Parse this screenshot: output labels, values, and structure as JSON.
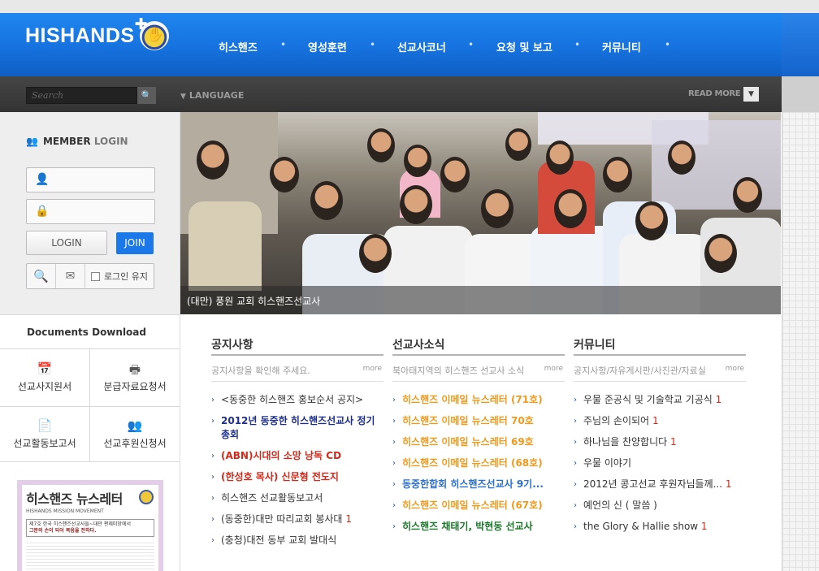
{
  "brand": {
    "logo_text": "HISHANDS",
    "logo_icon": "hand-cross-icon"
  },
  "nav": {
    "items": [
      {
        "label": "히스핸즈"
      },
      {
        "label": "영성훈련"
      },
      {
        "label": "선교사코너"
      },
      {
        "label": "요청 및 보고"
      },
      {
        "label": "커뮤니티"
      }
    ]
  },
  "toolbar": {
    "search_placeholder": "Search",
    "language_label": "LANGUAGE",
    "read_more_label": "READ MORE"
  },
  "member": {
    "title_bold": "MEMBER",
    "title_light": "LOGIN",
    "login_label": "LOGIN",
    "join_label": "JOIN",
    "keep_login_label": "로그인 유지"
  },
  "documents": {
    "title": "Documents Download",
    "items": [
      {
        "label": "선교사지원서",
        "icon": "calendar-icon"
      },
      {
        "label": "분급자료요청서",
        "icon": "printer-icon"
      },
      {
        "label": "선교활동보고서",
        "icon": "document-icon"
      },
      {
        "label": "선교후원신청서",
        "icon": "users-icon"
      }
    ]
  },
  "newsletter": {
    "title": "히스핸즈 뉴스레터",
    "subtitle": "HISHANDS MISSION MOVEMENT",
    "issue": "제7호",
    "headline1": "한국 히스핸즈선교사들~대만 편제미망에서",
    "headline2": "그분의 손이 되어 복음을 전하다."
  },
  "hero": {
    "caption": "(대만) 풍원 교회 히스핸즈선교사"
  },
  "boards": [
    {
      "title": "공지사항",
      "desc": "공지사항을 확인해 주세요.",
      "more": "more",
      "items": [
        {
          "text": "<동중한 히스핸즈 홍보순서 공지>",
          "count": ""
        },
        {
          "text": "2012년 동중한 히스핸즈선교사 정기총회",
          "count": ""
        },
        {
          "text": "(ABN)시대의 소망 낭독 CD",
          "count": ""
        },
        {
          "text": "(한성호 목사) 신문형 전도지",
          "count": ""
        },
        {
          "text": "히스핸즈 선교활동보고서",
          "count": ""
        },
        {
          "text": "(동중한)대만 따리교회 봉사대",
          "count": "1"
        },
        {
          "text": "(충청)대전 동부 교회 발대식",
          "count": ""
        }
      ]
    },
    {
      "title": "선교사소식",
      "desc": "북아태지역의 히스핸즈 선교사 소식",
      "more": "more",
      "items": [
        {
          "text": "히스핸즈 이메일 뉴스레터 (71호)"
        },
        {
          "text": "히스핸즈 이메일 뉴스레터 70호"
        },
        {
          "text": "히스핸즈 이메일 뉴스레터 69호"
        },
        {
          "text": "히스핸즈 이메일 뉴스레터 (68호)"
        },
        {
          "text": "동중한합회 히스핸즈선교사 9기..."
        },
        {
          "text": "히스핸즈 이메일 뉴스레터 (67호)"
        },
        {
          "text": "히스핸즈 채태기, 박현동 선교사"
        }
      ]
    },
    {
      "title": "커뮤니티",
      "desc": "공지사항/자유게시판/사진관/자료실",
      "more": "more",
      "items": [
        {
          "text": "우물 준공식 및 기술학교 기공식",
          "count": "1"
        },
        {
          "text": "주님의 손이되어",
          "count": "1"
        },
        {
          "text": "하나님을 찬양합니다",
          "count": "1"
        },
        {
          "text": "우물 이야기",
          "count": ""
        },
        {
          "text": "2012년 콩고선교 후원자님들께...",
          "count": "1"
        },
        {
          "text": "예언의 신 ( 말씀 )",
          "count": ""
        },
        {
          "text": "the Glory & Hallie show",
          "count": "1"
        }
      ]
    }
  ],
  "colors": {
    "header_blue": "#1672de",
    "join_blue": "#1b78e8",
    "link_navy": "#1d2f8a",
    "link_red": "#d22a1a",
    "link_orange": "#ef9a1c",
    "link_green": "#1b7a2a"
  }
}
